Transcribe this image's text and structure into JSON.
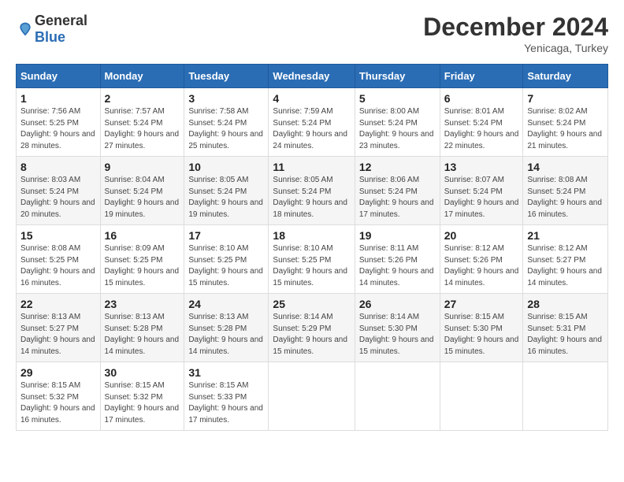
{
  "header": {
    "logo_general": "General",
    "logo_blue": "Blue",
    "month": "December 2024",
    "location": "Yenicaga, Turkey"
  },
  "weekdays": [
    "Sunday",
    "Monday",
    "Tuesday",
    "Wednesday",
    "Thursday",
    "Friday",
    "Saturday"
  ],
  "weeks": [
    [
      {
        "day": "1",
        "sunrise": "7:56 AM",
        "sunset": "5:25 PM",
        "daylight": "9 hours and 28 minutes."
      },
      {
        "day": "2",
        "sunrise": "7:57 AM",
        "sunset": "5:24 PM",
        "daylight": "9 hours and 27 minutes."
      },
      {
        "day": "3",
        "sunrise": "7:58 AM",
        "sunset": "5:24 PM",
        "daylight": "9 hours and 25 minutes."
      },
      {
        "day": "4",
        "sunrise": "7:59 AM",
        "sunset": "5:24 PM",
        "daylight": "9 hours and 24 minutes."
      },
      {
        "day": "5",
        "sunrise": "8:00 AM",
        "sunset": "5:24 PM",
        "daylight": "9 hours and 23 minutes."
      },
      {
        "day": "6",
        "sunrise": "8:01 AM",
        "sunset": "5:24 PM",
        "daylight": "9 hours and 22 minutes."
      },
      {
        "day": "7",
        "sunrise": "8:02 AM",
        "sunset": "5:24 PM",
        "daylight": "9 hours and 21 minutes."
      }
    ],
    [
      {
        "day": "8",
        "sunrise": "8:03 AM",
        "sunset": "5:24 PM",
        "daylight": "9 hours and 20 minutes."
      },
      {
        "day": "9",
        "sunrise": "8:04 AM",
        "sunset": "5:24 PM",
        "daylight": "9 hours and 19 minutes."
      },
      {
        "day": "10",
        "sunrise": "8:05 AM",
        "sunset": "5:24 PM",
        "daylight": "9 hours and 19 minutes."
      },
      {
        "day": "11",
        "sunrise": "8:05 AM",
        "sunset": "5:24 PM",
        "daylight": "9 hours and 18 minutes."
      },
      {
        "day": "12",
        "sunrise": "8:06 AM",
        "sunset": "5:24 PM",
        "daylight": "9 hours and 17 minutes."
      },
      {
        "day": "13",
        "sunrise": "8:07 AM",
        "sunset": "5:24 PM",
        "daylight": "9 hours and 17 minutes."
      },
      {
        "day": "14",
        "sunrise": "8:08 AM",
        "sunset": "5:24 PM",
        "daylight": "9 hours and 16 minutes."
      }
    ],
    [
      {
        "day": "15",
        "sunrise": "8:08 AM",
        "sunset": "5:25 PM",
        "daylight": "9 hours and 16 minutes."
      },
      {
        "day": "16",
        "sunrise": "8:09 AM",
        "sunset": "5:25 PM",
        "daylight": "9 hours and 15 minutes."
      },
      {
        "day": "17",
        "sunrise": "8:10 AM",
        "sunset": "5:25 PM",
        "daylight": "9 hours and 15 minutes."
      },
      {
        "day": "18",
        "sunrise": "8:10 AM",
        "sunset": "5:25 PM",
        "daylight": "9 hours and 15 minutes."
      },
      {
        "day": "19",
        "sunrise": "8:11 AM",
        "sunset": "5:26 PM",
        "daylight": "9 hours and 14 minutes."
      },
      {
        "day": "20",
        "sunrise": "8:12 AM",
        "sunset": "5:26 PM",
        "daylight": "9 hours and 14 minutes."
      },
      {
        "day": "21",
        "sunrise": "8:12 AM",
        "sunset": "5:27 PM",
        "daylight": "9 hours and 14 minutes."
      }
    ],
    [
      {
        "day": "22",
        "sunrise": "8:13 AM",
        "sunset": "5:27 PM",
        "daylight": "9 hours and 14 minutes."
      },
      {
        "day": "23",
        "sunrise": "8:13 AM",
        "sunset": "5:28 PM",
        "daylight": "9 hours and 14 minutes."
      },
      {
        "day": "24",
        "sunrise": "8:13 AM",
        "sunset": "5:28 PM",
        "daylight": "9 hours and 14 minutes."
      },
      {
        "day": "25",
        "sunrise": "8:14 AM",
        "sunset": "5:29 PM",
        "daylight": "9 hours and 15 minutes."
      },
      {
        "day": "26",
        "sunrise": "8:14 AM",
        "sunset": "5:30 PM",
        "daylight": "9 hours and 15 minutes."
      },
      {
        "day": "27",
        "sunrise": "8:15 AM",
        "sunset": "5:30 PM",
        "daylight": "9 hours and 15 minutes."
      },
      {
        "day": "28",
        "sunrise": "8:15 AM",
        "sunset": "5:31 PM",
        "daylight": "9 hours and 16 minutes."
      }
    ],
    [
      {
        "day": "29",
        "sunrise": "8:15 AM",
        "sunset": "5:32 PM",
        "daylight": "9 hours and 16 minutes."
      },
      {
        "day": "30",
        "sunrise": "8:15 AM",
        "sunset": "5:32 PM",
        "daylight": "9 hours and 17 minutes."
      },
      {
        "day": "31",
        "sunrise": "8:15 AM",
        "sunset": "5:33 PM",
        "daylight": "9 hours and 17 minutes."
      },
      null,
      null,
      null,
      null
    ]
  ]
}
